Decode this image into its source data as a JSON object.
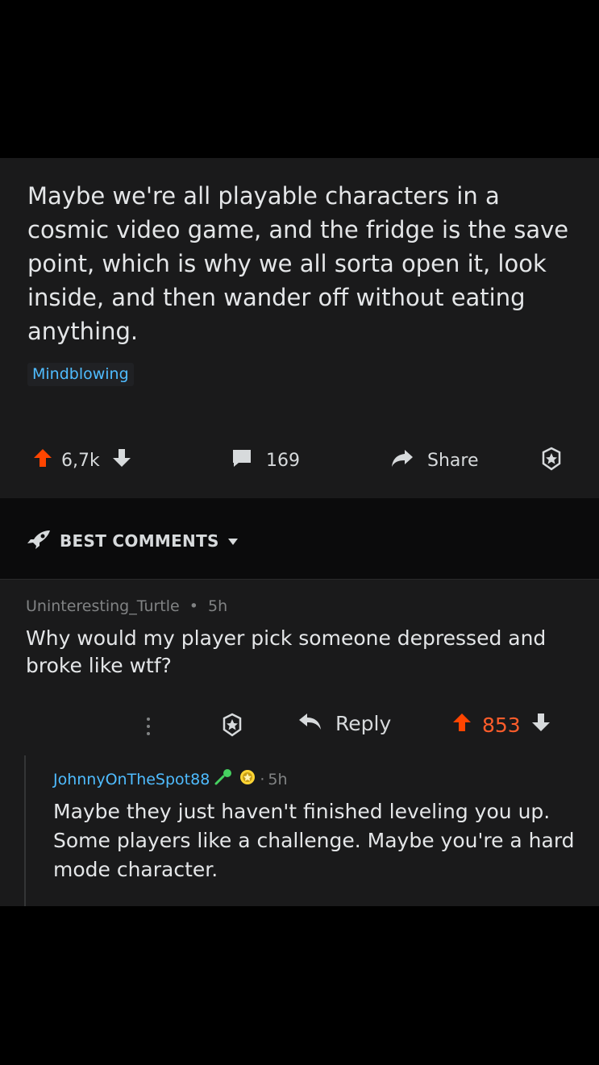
{
  "post": {
    "title": "Maybe we're all playable characters in a cosmic video game, and the fridge is the save point, which is why we all sorta open it, look inside, and then wander off without eating anything.",
    "flair": "Mindblowing",
    "upvotes": "6,7k",
    "comments": "169",
    "share_label": "Share"
  },
  "sort": {
    "label": "BEST COMMENTS"
  },
  "comment1": {
    "author": "Uninteresting_Turtle",
    "separator": "•",
    "time": "5h",
    "body": "Why would my player pick someone depressed and broke like wtf?",
    "reply_label": "Reply",
    "score": "853"
  },
  "comment2": {
    "author": "JohnnyOnTheSpot88",
    "separator": "·",
    "time": "5h",
    "body": "Maybe they just haven't finished leveling you up. Some players like a challenge. Maybe you're a hard mode character."
  },
  "colors": {
    "upvote": "#ff4500",
    "link_blue": "#4fbcff",
    "author_green": "#46d160",
    "award_gold": "#ffd635"
  },
  "icons": [
    "upvote-icon",
    "downvote-icon",
    "comment-icon",
    "share-icon",
    "award-icon",
    "rocket-icon",
    "caret-down-icon",
    "more-icon",
    "reply-icon",
    "microphone-icon",
    "gold-award-icon"
  ]
}
